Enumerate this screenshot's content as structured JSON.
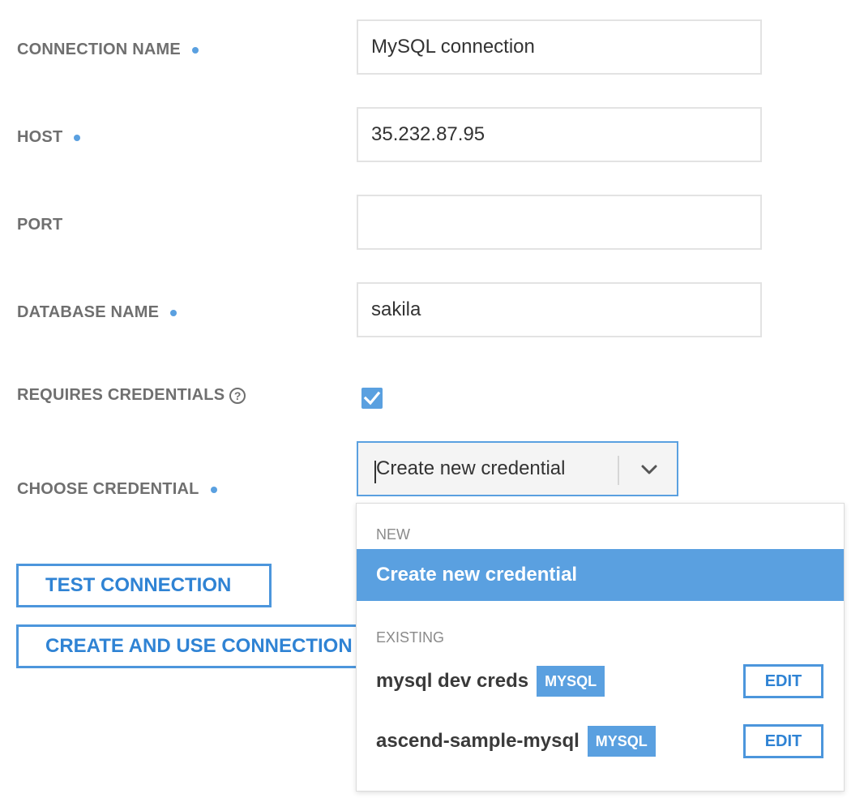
{
  "form": {
    "connection_name": {
      "label": "CONNECTION NAME",
      "value": "MySQL connection",
      "required": true
    },
    "host": {
      "label": "HOST",
      "value": "35.232.87.95",
      "required": true
    },
    "port": {
      "label": "PORT",
      "value": "",
      "required": false
    },
    "database_name": {
      "label": "DATABASE NAME",
      "value": "sakila",
      "required": true
    },
    "requires_credentials": {
      "label": "REQUIRES CREDENTIALS",
      "help_icon": "?",
      "checked": true
    },
    "choose_credential": {
      "label": "CHOOSE CREDENTIAL",
      "selected": "Create new credential",
      "required": true
    }
  },
  "buttons": {
    "test_connection": "TEST CONNECTION",
    "create_and_use_connection": "CREATE AND USE CONNECTION"
  },
  "dropdown": {
    "groups": {
      "new": {
        "header": "NEW",
        "option": "Create new credential"
      },
      "existing": {
        "header": "EXISTING",
        "items": [
          {
            "name": "mysql dev creds",
            "type": "MYSQL",
            "edit_label": "EDIT"
          },
          {
            "name": "ascend-sample-mysql",
            "type": "MYSQL",
            "edit_label": "EDIT"
          }
        ]
      }
    }
  },
  "icons": {
    "required_indicator": "dot-icon",
    "help": "question-circle-icon",
    "checkbox": "check-icon",
    "select_toggle": "chevron-down-icon"
  },
  "colors": {
    "accent": "#5aa0e0",
    "button_border": "#4c96dc",
    "button_text": "#2f83d4",
    "label_text": "#6f6f6f"
  }
}
